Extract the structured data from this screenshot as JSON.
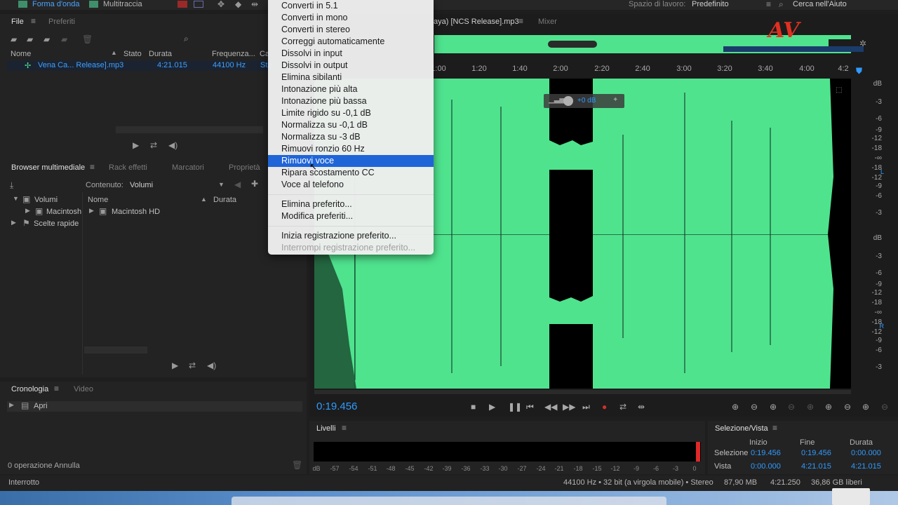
{
  "topbar": {
    "tab_waveform": "Forma d'onda",
    "tab_multitrack": "Multitraccia",
    "workspace_label": "Spazio di lavoro:",
    "workspace_value": "Predefinito",
    "search_help": "Cerca nell'Aiuto"
  },
  "files_panel": {
    "tab_file": "File",
    "tab_presets": "Preferiti",
    "columns": [
      "Nome",
      "Stato",
      "Durata",
      "Frequenza...",
      "Ca"
    ],
    "rows": [
      {
        "name": "Vena Ca... Release].mp3",
        "duration": "4:21.015",
        "rate": "44100 Hz",
        "channels": "Ste"
      }
    ]
  },
  "media_browser": {
    "tabs": [
      "Browser multimediale",
      "Rack effetti",
      "Marcatori",
      "Proprietà"
    ],
    "content_label": "Contenuto:",
    "content_value": "Volumi",
    "tree": [
      "Volumi",
      "Macintosh",
      "Scelte rapide"
    ],
    "col_name": "Nome",
    "col_duration": "Durata",
    "list_item": "Macintosh HD"
  },
  "history_panel": {
    "tab_history": "Cronologia",
    "tab_video": "Video",
    "item": "Apri",
    "undo_count": "0 operazione Annulla"
  },
  "editor": {
    "tab_file": "aya) [NCS Release].mp3",
    "tab_mixer": "Mixer",
    "time_labels": [
      "1:00",
      "1:20",
      "1:40",
      "2:00",
      "2:20",
      "2:40",
      "3:00",
      "3:20",
      "3:40",
      "4:00",
      "4:2"
    ],
    "db_top": [
      "dB",
      "-3",
      "-6",
      "-9",
      "-12",
      "-18",
      "-∞",
      "-18",
      "-12",
      "-9",
      "-6",
      "-3"
    ],
    "db_bottom": [
      "dB",
      "-3",
      "-6",
      "-9",
      "-12",
      "-18",
      "-∞",
      "-18",
      "-12",
      "-9",
      "-6",
      "-3"
    ],
    "hud_db": "+0 dB",
    "current_time": "0:19.456",
    "channel_left": "L",
    "channel_right": "R"
  },
  "dropdown_menu": {
    "items": [
      "Converti in 5.1",
      "Converti in mono",
      "Converti in stereo",
      "Correggi automaticamente",
      "Dissolvi in input",
      "Dissolvi in output",
      "Elimina sibilanti",
      "Intonazione più alta",
      "Intonazione più bassa",
      "Limite rigido su -0,1 dB",
      "Normalizza su -0,1 dB",
      "Normalizza su -3 dB",
      "Rimuovi ronzio 60 Hz",
      "Rimuovi voce",
      "Ripara scostamento CC",
      "Voce al telefono"
    ],
    "highlighted": "Rimuovi voce",
    "manage_items": [
      "Elimina preferito...",
      "Modifica preferiti..."
    ],
    "record_items": [
      "Inizia registrazione preferito...",
      "Interrompi registrazione preferito..."
    ]
  },
  "levels_panel": {
    "title": "Livelli",
    "ticks": [
      "dB",
      "-57",
      "-54",
      "-51",
      "-48",
      "-45",
      "-42",
      "-39",
      "-36",
      "-33",
      "-30",
      "-27",
      "-24",
      "-21",
      "-18",
      "-15",
      "-12",
      "-9",
      "-6",
      "-3",
      "0"
    ]
  },
  "selection_panel": {
    "title": "Selezione/Vista",
    "col_start": "Inizio",
    "col_end": "Fine",
    "col_duration": "Durata",
    "selection_label": "Selezione",
    "selection_start": "0:19.456",
    "selection_end": "0:19.456",
    "selection_duration": "0:00.000",
    "view_label": "Vista",
    "view_start": "0:00.000",
    "view_end": "4:21.015",
    "view_duration": "4:21.015"
  },
  "statusbar": {
    "left": "Interrotto",
    "format": "44100 Hz • 32 bit (a virgola mobile) • Stereo",
    "size": "87,90 MB",
    "duration": "4:21.250",
    "free": "36,86 GB liberi"
  },
  "colors": {
    "waveform": "#4fe38e",
    "selection_blue": "#2f9bff",
    "menu_highlight": "#1f65d8"
  }
}
